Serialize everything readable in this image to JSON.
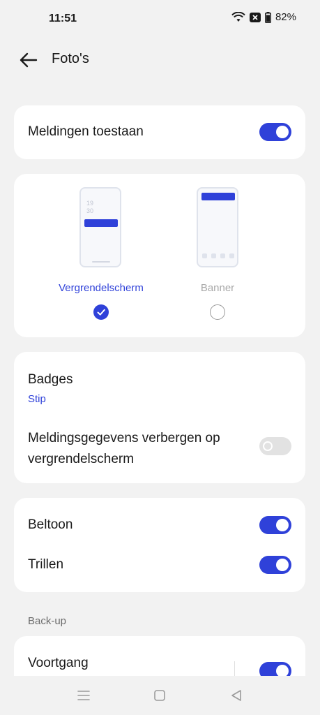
{
  "status": {
    "time": "11:51",
    "battery": "82%"
  },
  "header": {
    "title": "Foto's"
  },
  "allow_notifications": {
    "label": "Meldingen toestaan",
    "enabled": true
  },
  "styles": {
    "lock_time_hour": "19",
    "lock_time_min": "30",
    "options": [
      {
        "label": "Vergrendelscherm",
        "selected": true
      },
      {
        "label": "Banner",
        "selected": false
      }
    ]
  },
  "badges": {
    "label": "Badges",
    "value": "Stip"
  },
  "hide_details": {
    "label": "Meldingsgegevens verbergen op vergrendelscherm",
    "enabled": false
  },
  "ringtone": {
    "label": "Beltoon",
    "enabled": true
  },
  "vibrate": {
    "label": "Trillen",
    "enabled": true
  },
  "backup_section": {
    "header": "Back-up"
  },
  "progress": {
    "label": "Voortgang",
    "enabled": true
  },
  "colors": {
    "accent": "#2f41d9",
    "background": "#f2f2f2"
  }
}
